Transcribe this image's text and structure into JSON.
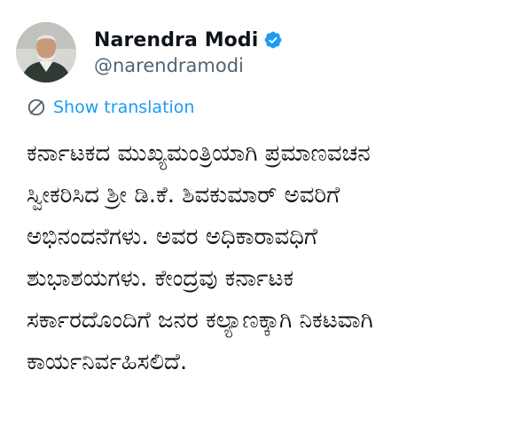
{
  "author": {
    "display_name": "Narendra Modi",
    "handle": "@narendramodi",
    "verified": true,
    "avatar_icon": "profile-photo-avatar"
  },
  "translate": {
    "label": "Show translation",
    "icon": "globe-icon",
    "color": "#1d9bf0"
  },
  "tweet": {
    "lines": [
      "ಕರ್ನಾಟಕದ ಮುಖ್ಯಮಂತ್ರಿಯಾಗಿ ಪ್ರಮಾಣವಚನ",
      "ಸ್ವೀಕರಿಸಿದ ಶ್ರೀ  ಡಿ.ಕೆ. ಶಿವಕುಮಾರ್ ಅವರಿಗೆ",
      "ಅಭಿನಂದನೆಗಳು. ಅವರ ಅಧಿಕಾರಾವಧಿಗೆ",
      "ಶುಭಾಶಯಗಳು. ಕೇಂದ್ರವು ಕರ್ನಾಟಕ",
      "ಸರ್ಕಾರದೊಂದಿಗೆ ಜನರ ಕಲ್ಯಾಣಕ್ಕಾಗಿ ನಿಕಟವಾಗಿ",
      "ಕಾರ್ಯನಿರ್ವಹಿಸಲಿದೆ."
    ]
  },
  "colors": {
    "text_primary": "#0f1419",
    "text_secondary": "#536471",
    "link": "#1d9bf0",
    "verified_badge": "#1d9bf0"
  }
}
